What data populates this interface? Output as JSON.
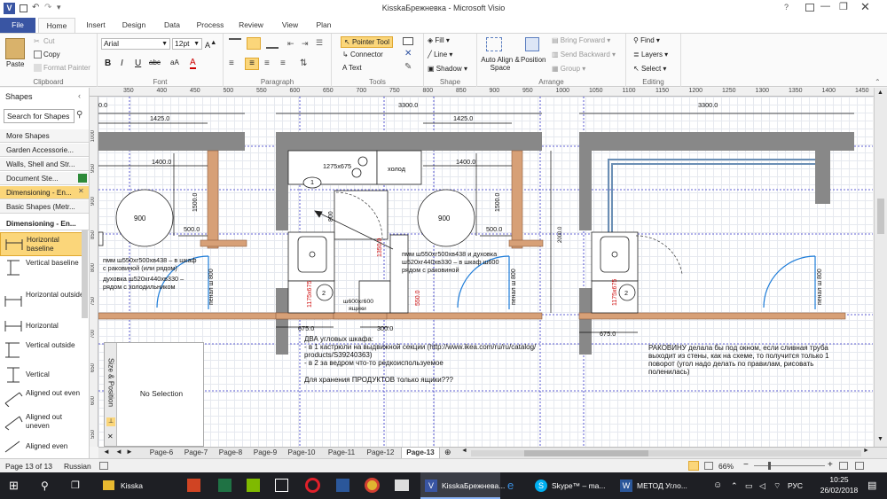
{
  "window": {
    "title": "KisskaБрежневка  -  Microsoft Visio",
    "app_icon": "V",
    "controls": [
      "minimize-icon",
      "restore-icon",
      "close-icon"
    ]
  },
  "ribbon_tabs": [
    "File",
    "Home",
    "Insert",
    "Design",
    "Data",
    "Process",
    "Review",
    "View",
    "Plan"
  ],
  "active_tab": "Home",
  "clipboard": {
    "paste": "Paste",
    "cut": "Cut",
    "copy": "Copy",
    "format_painter": "Format Painter",
    "label": "Clipboard"
  },
  "font": {
    "name": "Arial",
    "size": "12pt",
    "label": "Font",
    "bold": "B",
    "italic": "I",
    "underline": "U",
    "strike": "abc",
    "size_label": "aA",
    "color_label": "A"
  },
  "paragraph": {
    "label": "Paragraph"
  },
  "tools": {
    "pointer": "Pointer Tool",
    "connector": "Connector",
    "text": "Text",
    "label": "Tools"
  },
  "shape": {
    "fill": "Fill",
    "line": "Line",
    "shadow": "Shadow",
    "label": "Shape"
  },
  "arrange": {
    "auto_align": "Auto Align & Space",
    "position": "Position",
    "bring_forward": "Bring Forward",
    "send_backward": "Send Backward",
    "group": "Group",
    "label": "Arrange"
  },
  "editing": {
    "find": "Find",
    "layers": "Layers",
    "select": "Select",
    "label": "Editing"
  },
  "shapes_panel": {
    "title": "Shapes",
    "search_placeholder": "Search for Shapes",
    "stencils": [
      "More Shapes",
      "Garden Accessorie...",
      "Walls, Shell and Str...",
      "Document Ste...",
      "Dimensioning - En...",
      "Basic Shapes (Metr...",
      "Dimensioning - En..."
    ],
    "items": [
      "Horizontal baseline",
      "Vertical baseline",
      "Horizontal outside",
      "Horizontal",
      "Vertical outside",
      "Vertical",
      "Aligned out even",
      "Aligned out uneven",
      "Aligned even"
    ]
  },
  "size_position": {
    "title": "Size & Position",
    "value": "No Selection"
  },
  "ruler": {
    "top": [
      "350",
      "400",
      "450",
      "500",
      "550",
      "600",
      "650",
      "700",
      "750",
      "800",
      "850",
      "900",
      "950",
      "1000",
      "1050",
      "1100",
      "1150",
      "1200",
      "1250",
      "1300",
      "1350",
      "1400",
      "1450"
    ],
    "left": [
      "1000",
      "950",
      "900",
      "850",
      "800",
      "750",
      "700",
      "650",
      "600",
      "550"
    ]
  },
  "drawing": {
    "dim_3300_a": "3300.0",
    "dim_3300_b": "3300.0",
    "dim_1425_a": "1425.0",
    "dim_1425_b": "1425.0",
    "dim_1400_a": "1400.0",
    "dim_1400_b": "1400.0",
    "dim_1500_a": "1500.0",
    "dim_1500_b": "1500.0",
    "dim_500_a": "500.0",
    "dim_500_b": "500.0",
    "dim_675_a": "675.0",
    "dim_675_b": "675.0",
    "dim_300": "300.0",
    "dim_2000": "2000.0",
    "dim_1350": "1350.0",
    "dim_550": "550.0",
    "table_900_a": "900",
    "table_900_b": "900",
    "stove": "1275x675",
    "fridge": "холод",
    "cab_800": "800",
    "cab_1175_a": "1175x675",
    "cab_1175_b": "1175x675",
    "cab_1175_c": "1175x675",
    "num_1": "1",
    "num_2a": "2",
    "num_2b": "2",
    "num_2c": "2",
    "pen_800_a": "пенал ш 800",
    "pen_800_b": "пенал ш 800",
    "pen_800_c": "пенал ш 800",
    "box_600": "ш600хг600",
    "box_600_sub": "ящики",
    "dim_left_0": "0.0",
    "note_left_1": "пмм ш550хг500хв438 – в шкаф",
    "note_left_2": "с раковиной (или рядом)",
    "note_left_3": "духовка ш520хг440хв330 –",
    "note_left_4": "рядом с холодильником",
    "note_mid_1": "пмм ш550хг500хв438 и духовка",
    "note_mid_2": "ш520хг440хв330 – в шкаф ш600",
    "note_mid_3": "рядом с раковиной",
    "note_corner_1": "ДВА угловых шкафа:",
    "note_corner_2": "- в 1 кастрюли на выдвижной секции (http://www.ikea.com/ru/ru/catalog/",
    "note_corner_3": "products/S39240363)",
    "note_corner_4": "- в 2 за ведром что-то редкоиспользуемое",
    "note_corner_5": "Для хранения ПРОДУКТОВ только ящики???",
    "note_right_1": "РАКОВИНУ делала бы под окном, если сливная труба",
    "note_right_2": "выходит из стены, как на схеме, то получится только 1",
    "note_right_3": "поворот (угол надо делать по правилам, рисовать",
    "note_right_4": "поленилась)"
  },
  "page_tabs": [
    "Page-6",
    "Page-7",
    "Page-8",
    "Page-9",
    "Page-10",
    "Page-11",
    "Page-12",
    "Page-13"
  ],
  "active_page": "Page-13",
  "status": {
    "page": "Page 13 of 13",
    "language": "Russian",
    "zoom": "66%"
  },
  "taskbar": {
    "items": [
      "Kisska",
      "KisskaБрежнева...",
      "Skype™ – ma...",
      "МЕТОД Угло..."
    ],
    "lang": "РУС",
    "time": "10:25",
    "date": "26/02/2018"
  }
}
